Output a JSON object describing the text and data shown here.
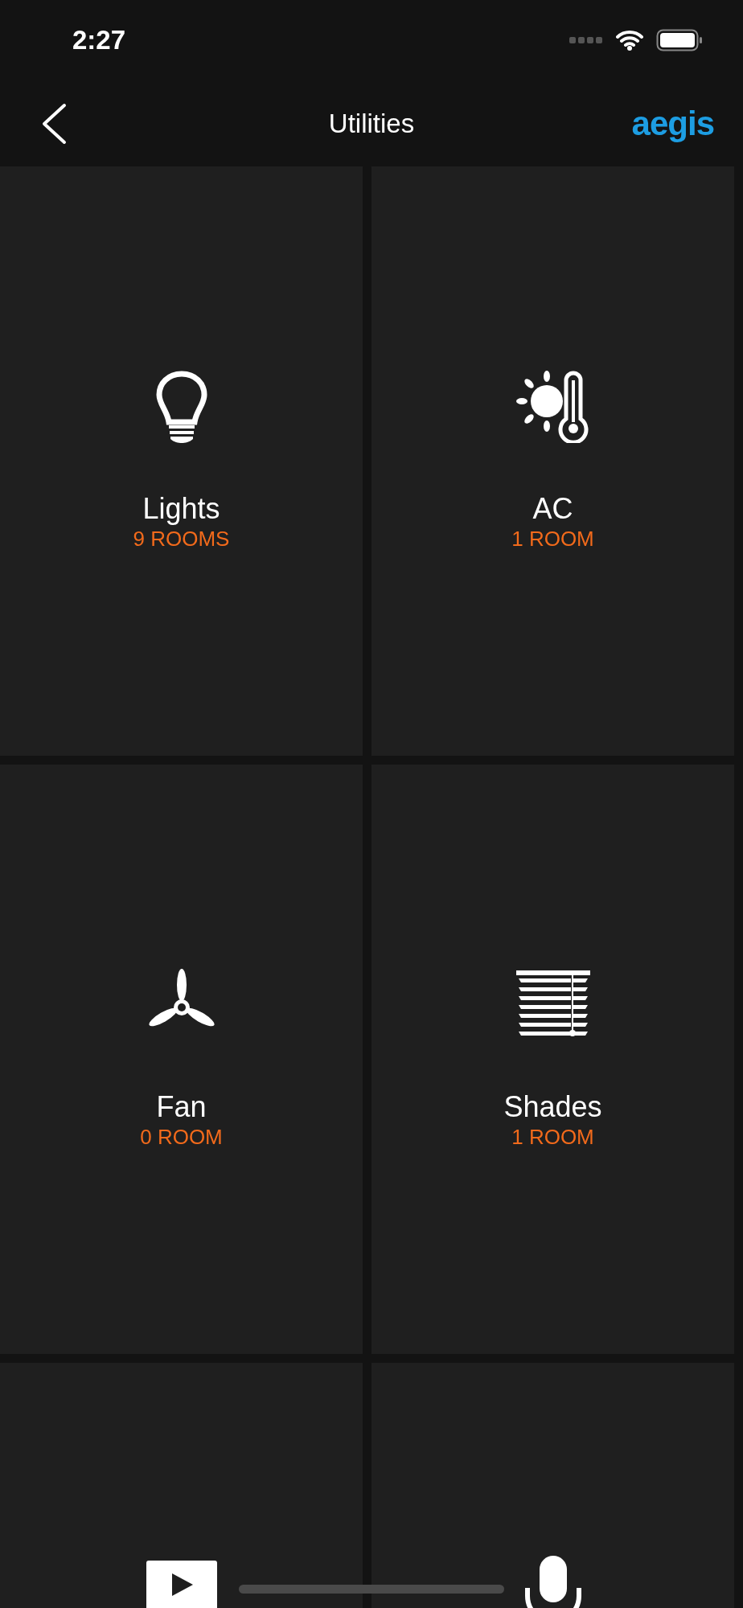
{
  "status_bar": {
    "time": "2:27"
  },
  "nav": {
    "title": "Utilities",
    "logo": "aegis"
  },
  "tiles": [
    {
      "kind": "bulb",
      "title": "Lights",
      "subtitle": "9 ROOMS"
    },
    {
      "kind": "climate",
      "title": "AC",
      "subtitle": "1 ROOM"
    },
    {
      "kind": "fan",
      "title": "Fan",
      "subtitle": "0 ROOM"
    },
    {
      "kind": "shades",
      "title": "Shades",
      "subtitle": "1 ROOM"
    },
    {
      "kind": "video"
    },
    {
      "kind": "mic"
    }
  ]
}
